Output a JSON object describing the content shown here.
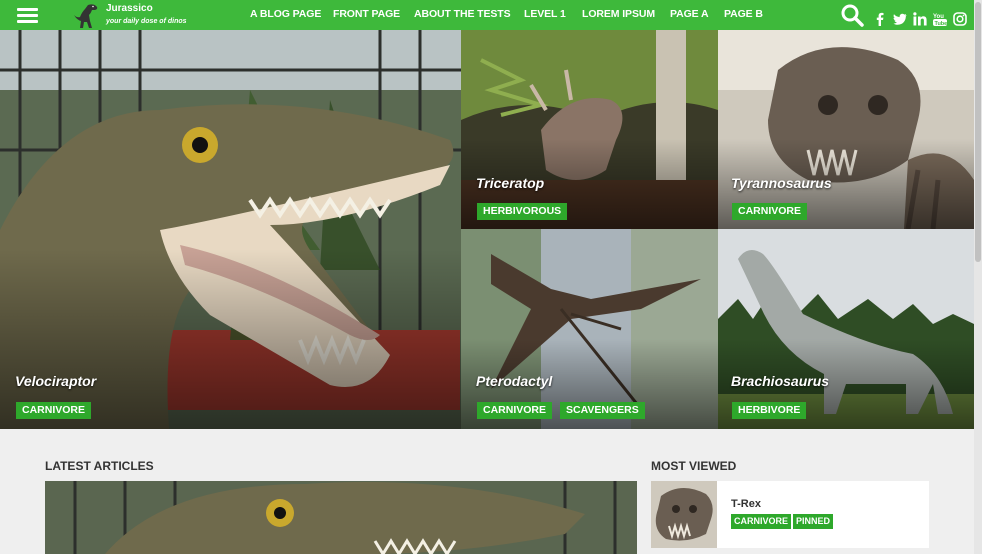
{
  "brand": {
    "name": "Jurassico",
    "tagline": "your daily dose of dinos"
  },
  "nav": {
    "items": [
      {
        "label": "A BLOG PAGE"
      },
      {
        "label": "FRONT PAGE"
      },
      {
        "label": "ABOUT THE TESTS"
      },
      {
        "label": "LEVEL 1"
      },
      {
        "label": "LOREM IPSUM"
      },
      {
        "label": "PAGE A"
      },
      {
        "label": "PAGE B"
      }
    ]
  },
  "social_icons": [
    "facebook-icon",
    "twitter-icon",
    "linkedin-icon",
    "youtube-icon",
    "instagram-icon"
  ],
  "hero": {
    "tiles": [
      {
        "title": "Velociraptor",
        "tags": [
          "CARNIVORE"
        ]
      },
      {
        "title": "Triceratop",
        "tags": [
          "HERBIVOROUS"
        ]
      },
      {
        "title": "Tyrannosaurus",
        "tags": [
          "CARNIVORE"
        ]
      },
      {
        "title": "Pterodactyl",
        "tags": [
          "CARNIVORE",
          "SCAVENGERS"
        ]
      },
      {
        "title": "Brachiosaurus",
        "tags": [
          "HERBIVORE"
        ]
      }
    ]
  },
  "sections": {
    "latest_heading": "LATEST ARTICLES",
    "most_viewed_heading": "MOST VIEWED"
  },
  "most_viewed": [
    {
      "title": "T-Rex",
      "tags": [
        "CARNIVORE",
        "PINNED"
      ]
    }
  ],
  "colors": {
    "accent": "#3eb93b",
    "tag": "#2ea82b"
  }
}
